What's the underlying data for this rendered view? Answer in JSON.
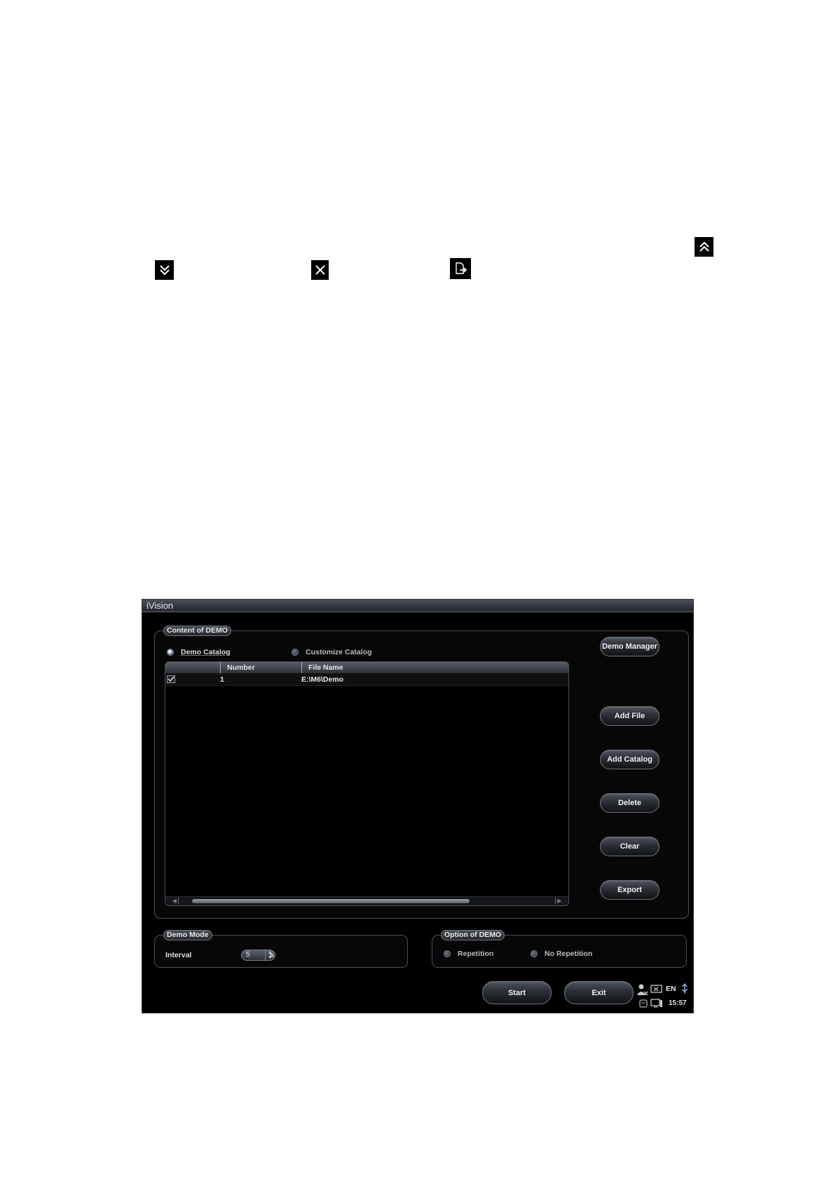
{
  "icons": {
    "top_right": "double-chevron-up-icon",
    "row2_a": "double-chevron-down-icon",
    "row2_b": "close-icon",
    "row2_c": "export-file-icon"
  },
  "window": {
    "title": "iVision"
  },
  "content_group": {
    "title": "Content of DEMO",
    "radio_demo_catalog": "Demo Catalog",
    "radio_customize_catalog": "Customize Catalog",
    "selected": "Demo Catalog",
    "columns": [
      "",
      "Number",
      "File Name"
    ],
    "rows": [
      {
        "checked": true,
        "number": "1",
        "file_name": "E:\\M6\\Demo"
      }
    ]
  },
  "buttons": {
    "demo_manager": "Demo Manager",
    "add_file": "Add File",
    "add_catalog": "Add Catalog",
    "delete": "Delete",
    "clear": "Clear",
    "export": "Export",
    "start": "Start",
    "exit": "Exit"
  },
  "demo_mode": {
    "title": "Demo Mode",
    "interval_label": "Interval",
    "interval_value": "5",
    "unit": "s"
  },
  "option_group": {
    "title": "Option of DEMO",
    "repetition": "Repetition",
    "no_repetition": "No Repetition",
    "selected": "Repetition"
  },
  "tray": {
    "language": "EN",
    "time": "15:57"
  },
  "colors": {
    "background": "#000000",
    "page": "#ffffff",
    "button_text": "#eef0f3"
  }
}
